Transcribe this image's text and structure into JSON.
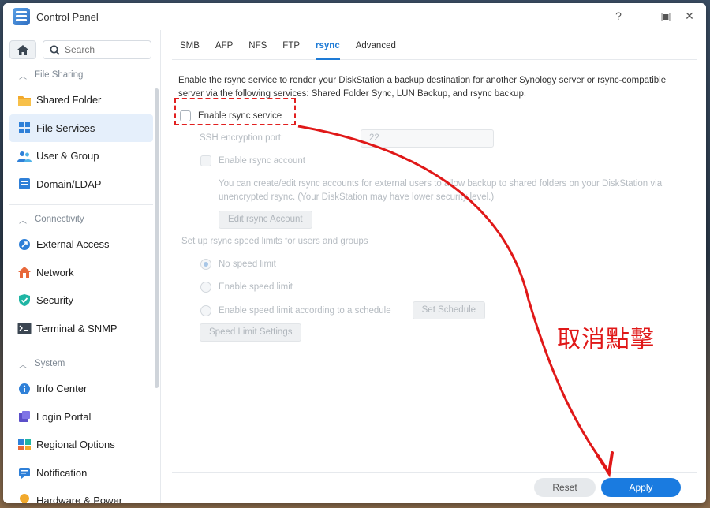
{
  "window": {
    "title": "Control Panel",
    "controls": [
      "?",
      "–",
      "▣",
      "✕"
    ]
  },
  "sidebar": {
    "search_placeholder": "Search",
    "groups": [
      {
        "label": "File Sharing",
        "items": [
          "Shared Folder",
          "File Services",
          "User & Group",
          "Domain/LDAP"
        ]
      },
      {
        "label": "Connectivity",
        "items": [
          "External Access",
          "Network",
          "Security",
          "Terminal & SNMP"
        ]
      },
      {
        "label": "System",
        "items": [
          "Info Center",
          "Login Portal",
          "Regional Options",
          "Notification",
          "Hardware & Power"
        ]
      }
    ],
    "active_item": "File Services"
  },
  "tabs": [
    "SMB",
    "AFP",
    "NFS",
    "FTP",
    "rsync",
    "Advanced"
  ],
  "active_tab": "rsync",
  "rsync": {
    "description": "Enable the rsync service to render your DiskStation a backup destination for another Synology server or rsync-compatible server via the following services: Shared Folder Sync, LUN Backup, and rsync backup.",
    "enable_label": "Enable rsync service",
    "ssh_port_label": "SSH encryption port:",
    "ssh_port_value": "22",
    "enable_account_label": "Enable rsync account",
    "account_note": "You can create/edit rsync accounts for external users to allow backup to shared folders on your DiskStation via unencrypted rsync. (Your DiskStation may have lower security level.)",
    "edit_account_btn": "Edit rsync Account",
    "speed_heading": "Set up rsync speed limits for users and groups",
    "no_limit": "No speed limit",
    "enable_limit": "Enable speed limit",
    "schedule_limit": "Enable speed limit according to a schedule",
    "set_schedule_btn": "Set Schedule",
    "speed_settings_btn": "Speed Limit Settings"
  },
  "footer": {
    "reset": "Reset",
    "apply": "Apply"
  },
  "annotation": {
    "text": "取消點擊",
    "color": "#e01818"
  }
}
